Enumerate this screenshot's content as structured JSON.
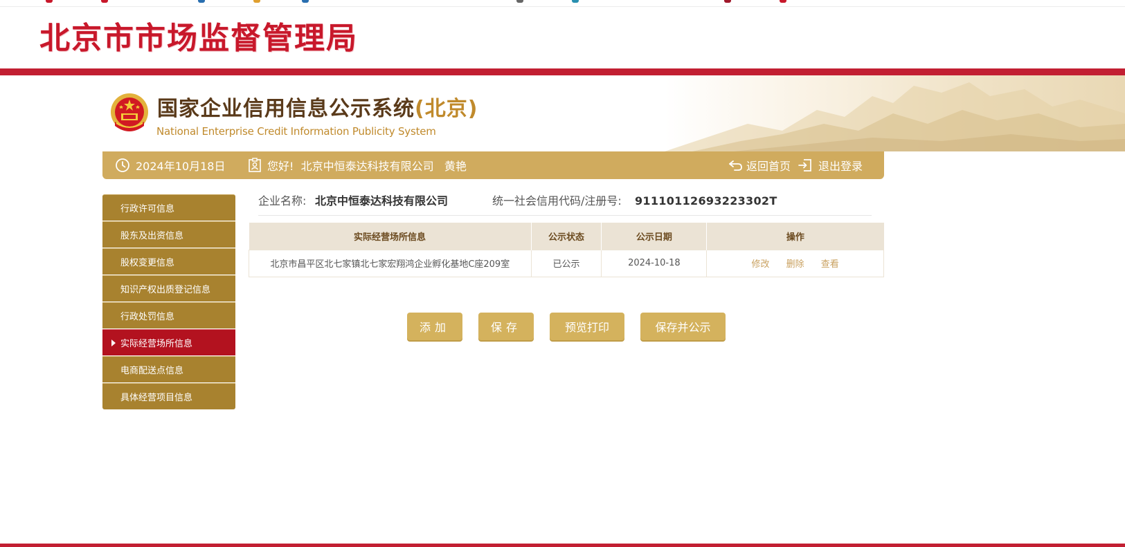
{
  "header": {
    "bureau_title": "北京市市场监督管理局"
  },
  "banner": {
    "system_title": "国家企业信用信息公示系统",
    "system_city": "(北京)",
    "system_subtitle": "National Enterprise Credit Information Publicity System"
  },
  "nav": {
    "date": "2024年10月18日",
    "greeting": "您好!  北京中恒泰达科技有限公司   黄艳",
    "home_label": "返回首页",
    "logout_label": "退出登录"
  },
  "sidebar": {
    "items": [
      {
        "label": "行政许可信息",
        "active": false
      },
      {
        "label": "股东及出资信息",
        "active": false
      },
      {
        "label": "股权变更信息",
        "active": false
      },
      {
        "label": "知识产权出质登记信息",
        "active": false
      },
      {
        "label": "行政处罚信息",
        "active": false
      },
      {
        "label": "实际经营场所信息",
        "active": true
      },
      {
        "label": "电商配送点信息",
        "active": false
      },
      {
        "label": "具体经营项目信息",
        "active": false
      }
    ]
  },
  "company": {
    "name_label": "企业名称:",
    "name_value": "北京中恒泰达科技有限公司",
    "code_label": "统一社会信用代码/注册号:",
    "code_value": "91110112693223302T"
  },
  "table": {
    "headers": [
      "实际经营场所信息",
      "公示状态",
      "公示日期",
      "操作"
    ],
    "rows": [
      {
        "address": "北京市昌平区北七家镇北七家宏翔鸿企业孵化基地C座209室",
        "status": "已公示",
        "date": "2024-10-18",
        "actions": [
          "修改",
          "删除",
          "查看"
        ]
      }
    ]
  },
  "buttons": {
    "add": "添加",
    "save": "保存",
    "preview": "预览打印",
    "publish": "保存并公示"
  },
  "colors": {
    "brand_red": "#c21f32",
    "gold": "#d0ab5e",
    "sidebar_gold": "#a8822f",
    "active_red": "#b3121f"
  }
}
